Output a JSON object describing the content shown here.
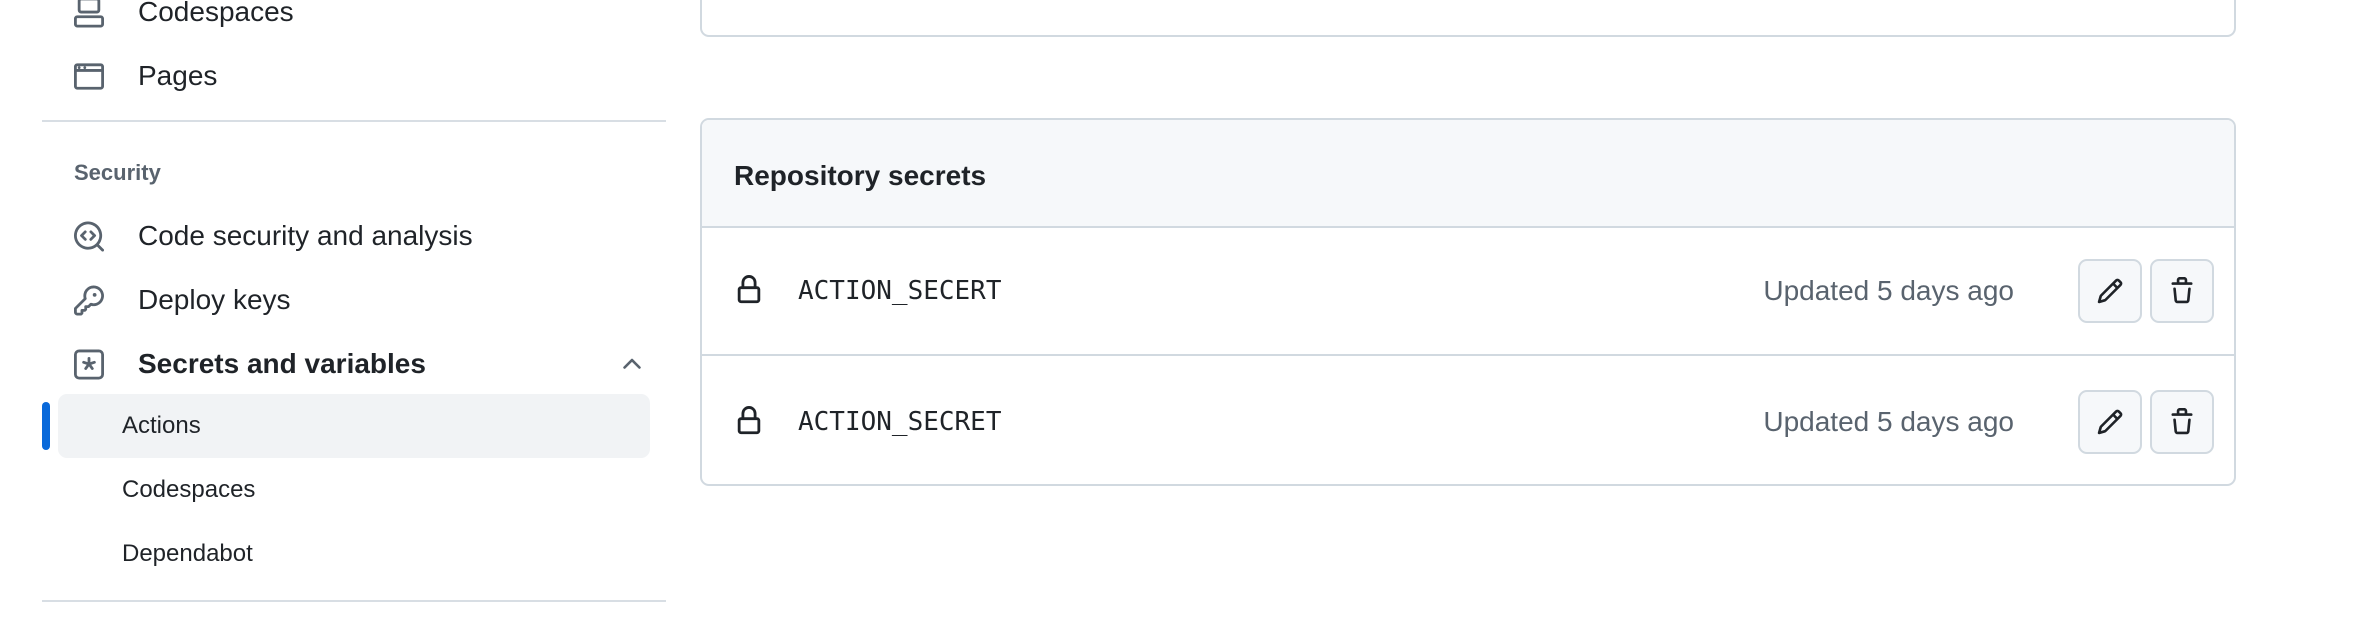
{
  "sidebar": {
    "items_top": [
      {
        "label": "Codespaces",
        "icon": "codespaces-icon"
      },
      {
        "label": "Pages",
        "icon": "browser-icon"
      }
    ],
    "security": {
      "section_title": "Security",
      "items": [
        {
          "label": "Code security and analysis",
          "icon": "codescan-icon"
        },
        {
          "label": "Deploy keys",
          "icon": "key-icon"
        },
        {
          "label": "Secrets and variables",
          "icon": "asterisk-icon"
        }
      ],
      "sub_items": [
        {
          "label": "Actions"
        },
        {
          "label": "Codespaces"
        },
        {
          "label": "Dependabot"
        }
      ]
    }
  },
  "main": {
    "repository_secrets": {
      "title": "Repository secrets",
      "rows": [
        {
          "name": "ACTION_SECERT",
          "updated": "Updated 5 days ago"
        },
        {
          "name": "ACTION_SECRET",
          "updated": "Updated 5 days ago"
        }
      ]
    }
  },
  "colors": {
    "accent": "#0969da",
    "border": "#d1d9e0",
    "muted_text": "#59636e",
    "header_bg": "#f6f8fa"
  }
}
